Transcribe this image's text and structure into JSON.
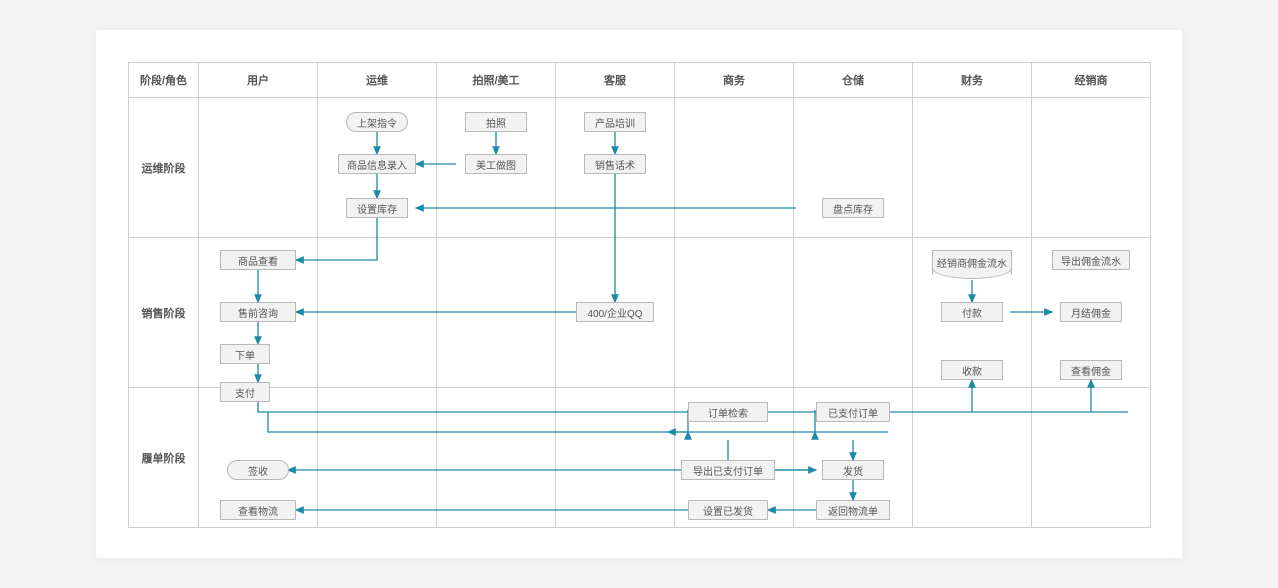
{
  "diagram": {
    "title": "阶段/角色",
    "columns": [
      "用户",
      "运维",
      "拍照/美工",
      "客服",
      "商务",
      "仓储",
      "财务",
      "经销商"
    ],
    "rows": [
      "运维阶段",
      "销售阶段",
      "履单阶段"
    ],
    "nodes": {
      "listing_cmd": "上架指令",
      "take_photo": "拍照",
      "product_training": "产品培训",
      "product_entry": "商品信息录入",
      "art_edit": "美工做图",
      "sales_script": "销售话术",
      "set_stock": "设置库存",
      "inventory_check": "盘点库存",
      "view_product": "商品查看",
      "presale_consult": "售前咨询",
      "place_order": "下单",
      "pay": "支付",
      "qq400": "400/企业QQ",
      "dist_flow": "经销商佣金流水",
      "export_flow": "导出佣金流水",
      "pay2": "付款",
      "monthly_comm": "月结佣金",
      "receive": "收款",
      "view_comm": "查看佣金",
      "order_search": "订单检索",
      "paid_order": "已支付订单",
      "export_paid": "导出已支付订单",
      "ship": "发货",
      "sign": "签收",
      "return_logi": "返回物流单",
      "view_logi": "查看物流",
      "set_shipped": "设置已发货"
    },
    "arrow_color": "#1a8aa8"
  }
}
